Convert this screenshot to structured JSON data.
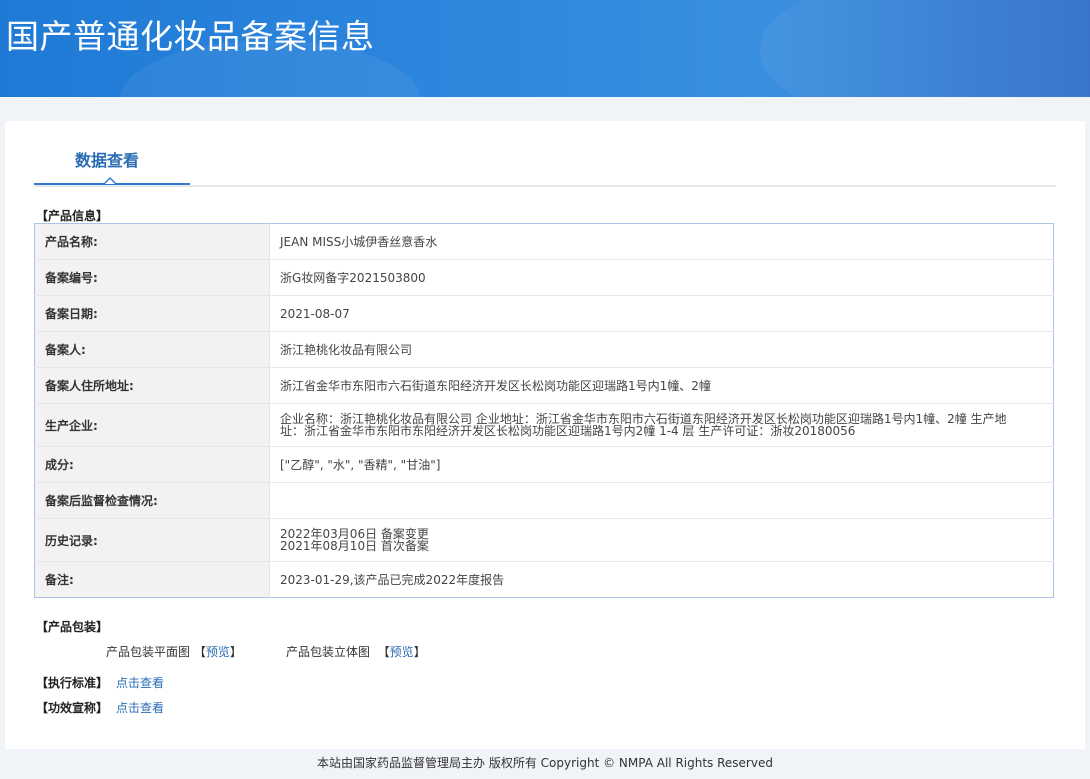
{
  "header": {
    "title": "国产普通化妆品备案信息"
  },
  "tabs": [
    {
      "label": "数据查看"
    }
  ],
  "product_info": {
    "section_title": "【产品信息】",
    "rows": [
      {
        "label": "产品名称:",
        "value": "JEAN MISS小城伊香丝意香水"
      },
      {
        "label": "备案编号:",
        "value": "浙G妆网备字2021503800"
      },
      {
        "label": "备案日期:",
        "value": "2021-08-07"
      },
      {
        "label": "备案人:",
        "value": "浙江艳桃化妆品有限公司"
      },
      {
        "label": "备案人住所地址:",
        "value": "浙江省金华市东阳市六石街道东阳经济开发区长松岗功能区迎瑞路1号内1幢、2幢"
      },
      {
        "label": "生产企业:",
        "value_lines": [
          "企业名称：浙江艳桃化妆品有限公司 企业地址：浙江省金华市东阳市六石街道东阳经济开发区长松岗功能区迎瑞路1号内1幢、2幢 生产地",
          "址：浙江省金华市东阳市东阳经济开发区长松岗功能区迎瑞路1号内2幢 1-4 层 生产许可证：浙妆20180056"
        ]
      },
      {
        "label": "成分:",
        "value": "[\"乙醇\", \"水\", \"香精\", \"甘油\"]"
      },
      {
        "label": "备案后监督检查情况:",
        "value": ""
      },
      {
        "label": "历史记录:",
        "value_lines": [
          "2022年03月06日 备案变更",
          "2021年08月10日 首次备案"
        ]
      },
      {
        "label": "备注:",
        "value": "2023-01-29,该产品已完成2022年度报告"
      }
    ]
  },
  "packaging": {
    "section_title": "【产品包装】",
    "flat_label": "产品包装平面图",
    "flat_link": "预览",
    "solid_label": "产品包装立体图",
    "solid_link": "预览"
  },
  "standard": {
    "label": "【执行标准】",
    "link": "点击查看"
  },
  "efficacy": {
    "label": "【功效宣称】",
    "link": "点击查看"
  },
  "footer": {
    "text": "本站由国家药品监督管理局主办 版权所有 Copyright © NMPA All Rights Reserved"
  }
}
